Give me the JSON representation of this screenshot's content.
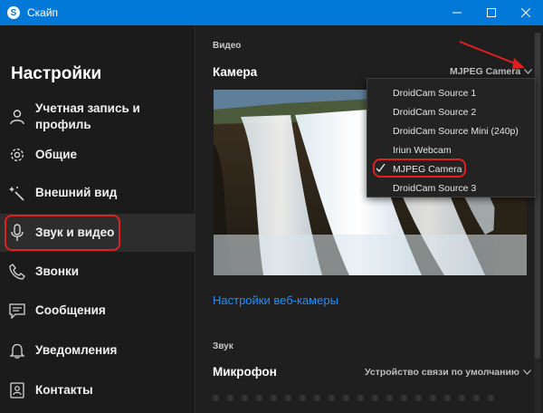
{
  "window": {
    "title": "Скайп"
  },
  "sidebar": {
    "title": "Настройки",
    "items": [
      {
        "label": "Учетная запись и профиль",
        "icon": "person-icon"
      },
      {
        "label": "Общие",
        "icon": "gear-icon"
      },
      {
        "label": "Внешний вид",
        "icon": "magic-wand-icon"
      },
      {
        "label": "Звук и видео",
        "icon": "microphone-icon"
      },
      {
        "label": "Звонки",
        "icon": "phone-icon"
      },
      {
        "label": "Сообщения",
        "icon": "chat-icon"
      },
      {
        "label": "Уведомления",
        "icon": "bell-icon"
      },
      {
        "label": "Контакты",
        "icon": "contacts-icon"
      }
    ]
  },
  "video": {
    "section_label": "Видео",
    "camera_label": "Камера",
    "camera_value": "MJPEG Camera",
    "webcam_settings_link": "Настройки веб-камеры"
  },
  "camera_menu": {
    "options": [
      {
        "label": "DroidCam Source 1",
        "selected": false
      },
      {
        "label": "DroidCam Source 2",
        "selected": false
      },
      {
        "label": "DroidCam Source Mini (240p)",
        "selected": false
      },
      {
        "label": "Iriun Webcam",
        "selected": false
      },
      {
        "label": "MJPEG Camera",
        "selected": true
      },
      {
        "label": "DroidCam Source 3",
        "selected": false
      }
    ]
  },
  "audio": {
    "section_label": "Звук",
    "microphone_label": "Микрофон",
    "microphone_value": "Устройство связи по умолчанию"
  },
  "colors": {
    "titlebar": "#0078d7",
    "accent_link": "#1e90ff",
    "highlight": "#e02020"
  }
}
